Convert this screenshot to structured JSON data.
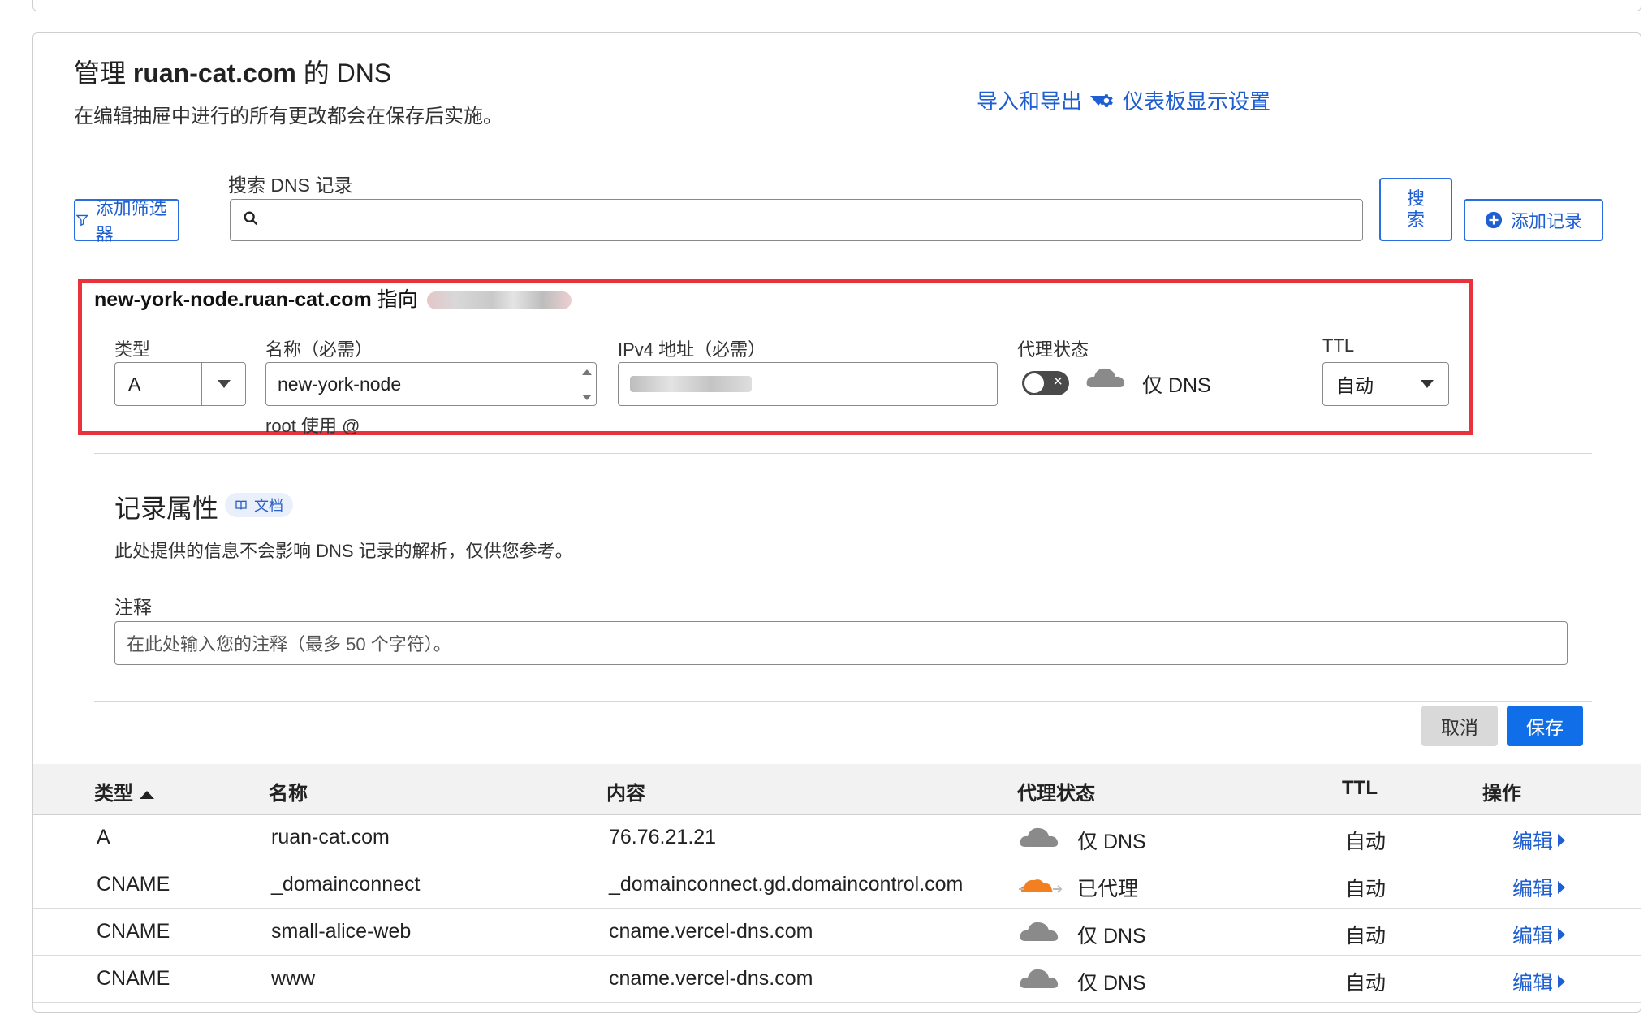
{
  "header": {
    "title_prefix": "管理",
    "title_domain": "ruan-cat.com",
    "title_suffix": "的 DNS",
    "subtitle": "在编辑抽屉中进行的所有更改都会在保存后实施。",
    "import_export": "导入和导出",
    "dashboard_settings": "仪表板显示设置"
  },
  "toolbar": {
    "add_filter": "添加筛选器",
    "search_label": "搜索 DNS 记录",
    "search_placeholder": "",
    "search_button": "搜\n索",
    "add_record": "添加记录"
  },
  "editor": {
    "record_name": "new-york-node.ruan-cat.com",
    "points_to": "指向",
    "type_label": "类型",
    "type_value": "A",
    "name_label": "名称（必需）",
    "name_value": "new-york-node",
    "name_hint": "root 使用 @",
    "ipv4_label": "IPv4 地址（必需）",
    "proxy_label": "代理状态",
    "proxy_value": "仅 DNS",
    "ttl_label": "TTL",
    "ttl_value": "自动"
  },
  "attributes": {
    "title": "记录属性",
    "doc_badge": "文档",
    "description": "此处提供的信息不会影响 DNS 记录的解析，仅供您参考。",
    "note_label": "注释",
    "note_placeholder": "在此处输入您的注释（最多 50 个字符）。"
  },
  "actions": {
    "cancel": "取消",
    "save": "保存"
  },
  "table": {
    "columns": [
      "类型",
      "名称",
      "内容",
      "代理状态",
      "TTL",
      "操作"
    ],
    "rows": [
      {
        "type": "A",
        "name": "ruan-cat.com",
        "content": "76.76.21.21",
        "proxy": "仅 DNS",
        "proxied": false,
        "ttl": "自动",
        "action": "编辑"
      },
      {
        "type": "CNAME",
        "name": "_domainconnect",
        "content": "_domainconnect.gd.domaincontrol.com",
        "proxy": "已代理",
        "proxied": true,
        "ttl": "自动",
        "action": "编辑"
      },
      {
        "type": "CNAME",
        "name": "small-alice-web",
        "content": "cname.vercel-dns.com",
        "proxy": "仅 DNS",
        "proxied": false,
        "ttl": "自动",
        "action": "编辑"
      },
      {
        "type": "CNAME",
        "name": "www",
        "content": "cname.vercel-dns.com",
        "proxy": "仅 DNS",
        "proxied": false,
        "ttl": "自动",
        "action": "编辑"
      }
    ]
  },
  "colors": {
    "accent": "#1f5fd1",
    "primary_button": "#0f6ee8",
    "highlight_border": "#e8323c",
    "proxied_cloud": "#f38020",
    "dns_only_cloud": "#8a8a8a"
  }
}
